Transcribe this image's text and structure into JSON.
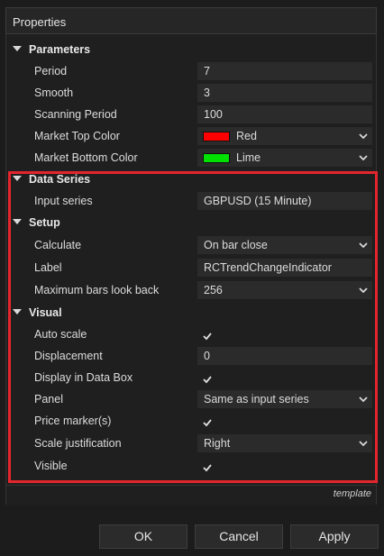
{
  "window": {
    "title": "Properties"
  },
  "categories": {
    "parameters": "Parameters",
    "data_series": "Data Series",
    "setup": "Setup",
    "visual": "Visual"
  },
  "properties": {
    "period": {
      "label": "Period",
      "value": "7"
    },
    "smooth": {
      "label": "Smooth",
      "value": "3"
    },
    "scanning_period": {
      "label": "Scanning Period",
      "value": "100"
    },
    "market_top_color": {
      "label": "Market Top Color",
      "value": "Red",
      "swatch": "#ff0000"
    },
    "market_bottom_color": {
      "label": "Market Bottom Color",
      "value": "Lime",
      "swatch": "#00e000"
    },
    "input_series": {
      "label": "Input series",
      "value": "GBPUSD (15 Minute)"
    },
    "calculate": {
      "label": "Calculate",
      "value": "On bar close"
    },
    "label": {
      "label": "Label",
      "value": "RCTrendChangeIndicator"
    },
    "max_bars": {
      "label": "Maximum bars look back",
      "value": "256"
    },
    "auto_scale": {
      "label": "Auto scale",
      "checked": true
    },
    "displacement": {
      "label": "Displacement",
      "value": "0"
    },
    "display_data_box": {
      "label": "Display in Data Box",
      "checked": true
    },
    "panel": {
      "label": "Panel",
      "value": "Same as input series"
    },
    "price_markers": {
      "label": "Price marker(s)",
      "checked": true
    },
    "scale_justification": {
      "label": "Scale justification",
      "value": "Right"
    },
    "visible": {
      "label": "Visible",
      "checked": true
    }
  },
  "footer": {
    "template_label": "template"
  },
  "buttons": {
    "ok": "OK",
    "cancel": "Cancel",
    "apply": "Apply"
  },
  "colors": {
    "highlight": "#e3262d",
    "background": "#1c1c1c",
    "field": "#2b2b2b"
  }
}
